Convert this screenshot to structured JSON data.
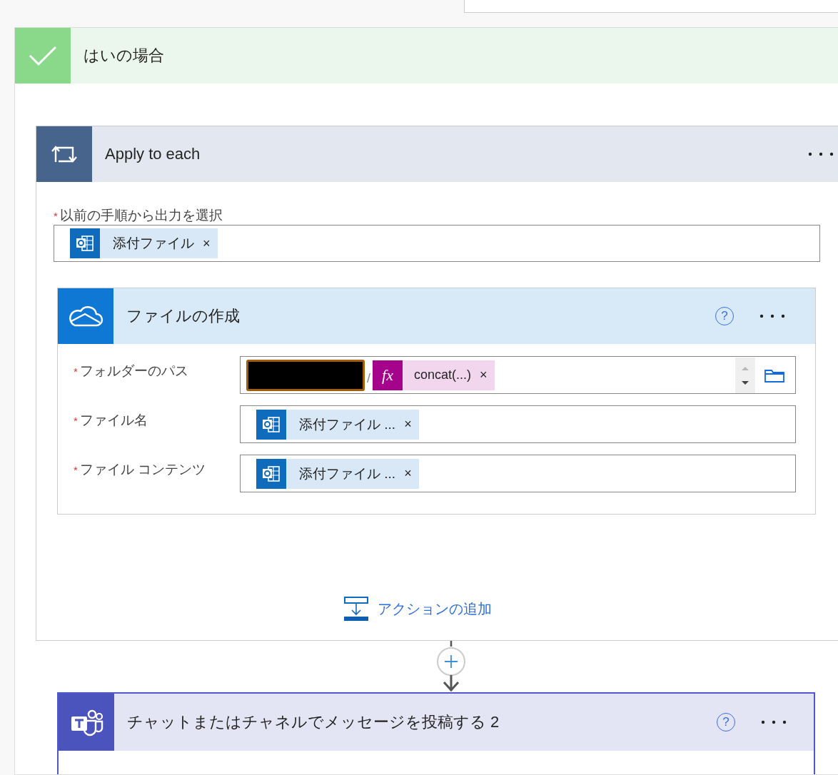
{
  "condition": {
    "title": "はいの場合"
  },
  "loop": {
    "title": "Apply to each",
    "field": {
      "mark": "*",
      "label": "以前の手順から出力を選択",
      "tokens": [
        {
          "kind": "outlook",
          "text": "添付ファイル",
          "remove": "×"
        }
      ]
    },
    "action": {
      "title": "ファイルの作成",
      "help": "?",
      "fields": [
        {
          "mark": "*",
          "label": "フォルダーのパス",
          "picker": true,
          "tokens": [
            {
              "kind": "redacted"
            },
            {
              "kind": "separator",
              "text": "/"
            },
            {
              "kind": "expression",
              "badge": "fx",
              "text": "concat(...)",
              "remove": "×"
            }
          ]
        },
        {
          "mark": "*",
          "label": "ファイル名",
          "picker": false,
          "tokens": [
            {
              "kind": "outlook",
              "text": "添付ファイル ...",
              "remove": "×"
            }
          ]
        },
        {
          "mark": "*",
          "label": "ファイル コンテンツ",
          "picker": false,
          "tokens": [
            {
              "kind": "outlook",
              "text": "添付ファイル ...",
              "remove": "×"
            }
          ]
        }
      ]
    },
    "add_action": "アクションの追加"
  },
  "next_action": {
    "title": "チャットまたはチャネルでメッセージを投稿する 2",
    "help": "?"
  }
}
